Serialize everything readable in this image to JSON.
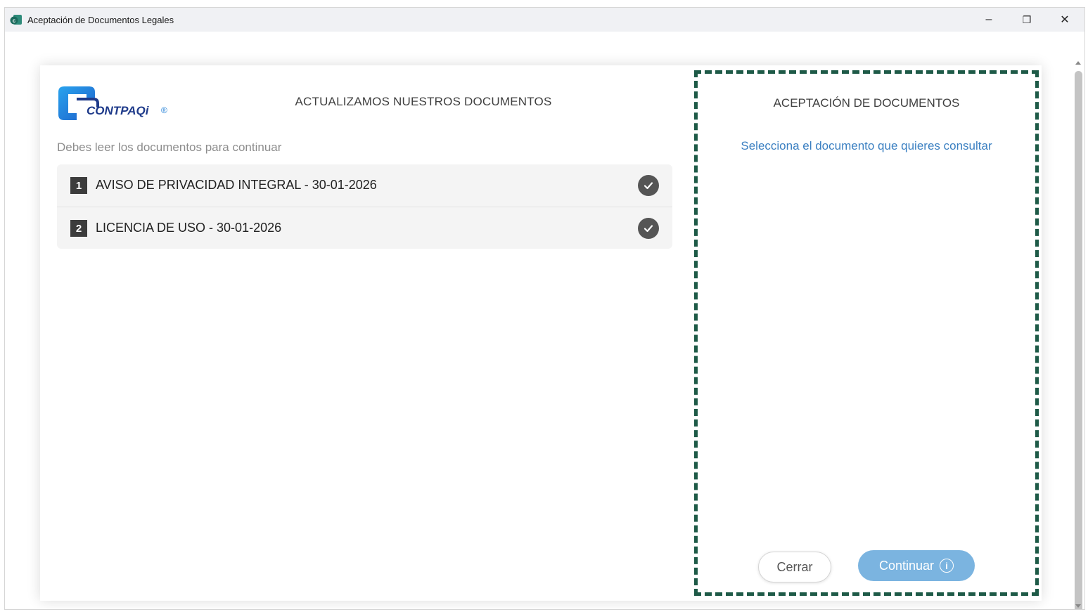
{
  "window": {
    "title": "Aceptación de Documentos Legales",
    "minimize_glyph": "–",
    "restore_glyph": "❐",
    "close_glyph": "✕"
  },
  "logo": {
    "text": "CONTPAQi",
    "registered": "®"
  },
  "header": {
    "title": "ACTUALIZAMOS NUESTROS DOCUMENTOS"
  },
  "left": {
    "subtitle": "Debes leer los documentos para continuar"
  },
  "documents": [
    {
      "number": "1",
      "label": "AVISO DE PRIVACIDAD INTEGRAL - 30-01-2026",
      "read": true
    },
    {
      "number": "2",
      "label": "LICENCIA DE USO - 30-01-2026",
      "read": true
    }
  ],
  "right": {
    "title": "ACEPTACIÓN DE DOCUMENTOS",
    "hint": "Selecciona el documento que quieres consultar",
    "close_label": "Cerrar",
    "continue_label": "Continuar",
    "continue_info_glyph": "i"
  },
  "colors": {
    "accent_blue": "#3a7fc1",
    "continue_button": "#7bb4e0",
    "dashed_border": "#1e5a47",
    "logo_blue": "#1f7ed6",
    "logo_navy": "#1e3a8a"
  },
  "icons": {
    "check": "checkmark-icon",
    "app": "app-icon",
    "info": "info-icon"
  }
}
